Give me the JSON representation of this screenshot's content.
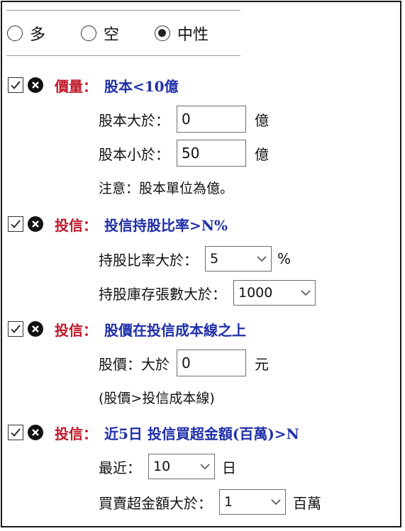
{
  "direction": {
    "options": [
      "多",
      "空",
      "中性"
    ],
    "selected": 2
  },
  "sections": [
    {
      "category": "價量：",
      "title": "股本<10億",
      "fields": [
        {
          "label": "股本大於：",
          "value": "0",
          "unit": "億"
        },
        {
          "label": "股本小於：",
          "value": "50",
          "unit": "億"
        }
      ],
      "note": "注意：股本單位為億。"
    },
    {
      "category": "投信：",
      "title": "投信持股比率>N%",
      "fields": [
        {
          "label": "持股比率大於：",
          "value": "5",
          "unit": "%"
        },
        {
          "label": "持股庫存張數大於：",
          "value": "1000"
        }
      ]
    },
    {
      "category": "投信：",
      "title": "股價在投信成本線之上",
      "fields": [
        {
          "label": "股價：大於",
          "value": "0",
          "unit": "元"
        }
      ],
      "note": "(股價>投信成本線)"
    },
    {
      "category": "投信：",
      "title": "近5日 投信買超金額(百萬)>N",
      "fields": [
        {
          "label": "最近：",
          "value": "10",
          "unit": "日"
        },
        {
          "label": "買賣超金額大於：",
          "value": "1",
          "unit": "百萬"
        }
      ]
    }
  ],
  "icons": {
    "checkbox": "checked-checkbox-icon",
    "delete": "remove-circle-icon",
    "dropdown": "chevron-down-icon"
  },
  "colors": {
    "category": "#c0182a",
    "title": "#1f2fa8"
  }
}
